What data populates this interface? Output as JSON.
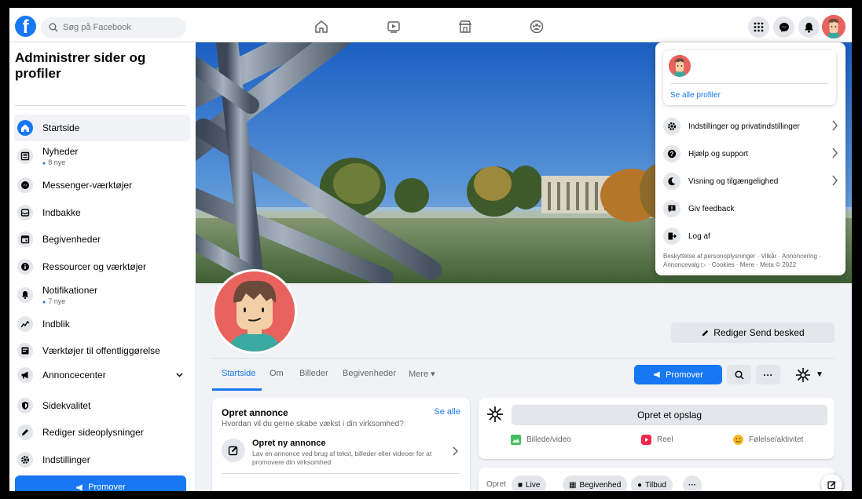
{
  "topbar": {
    "logo_letter": "f",
    "search_placeholder": "Søg på Facebook"
  },
  "sidebar": {
    "title": "Administrer sider og profiler",
    "items": [
      {
        "label": "Startside",
        "icon": "home-icon"
      },
      {
        "label": "Nyheder",
        "sub": "8 nye",
        "icon": "news-icon"
      },
      {
        "label": "Messenger-værktøjer",
        "icon": "messenger-icon"
      },
      {
        "label": "Indbakke",
        "icon": "inbox-icon"
      },
      {
        "label": "Begivenheder",
        "icon": "calendar-icon"
      },
      {
        "label": "Ressourcer og værktøjer",
        "icon": "info-icon"
      },
      {
        "label": "Notifikationer",
        "sub": "7 nye",
        "icon": "bell-icon"
      },
      {
        "label": "Indblik",
        "icon": "insights-icon"
      },
      {
        "label": "Værktøjer til offentliggørelse",
        "icon": "publishing-icon"
      },
      {
        "label": "Annoncecenter",
        "icon": "megaphone-icon"
      },
      {
        "label": "Sidekvalitet",
        "icon": "shield-icon"
      },
      {
        "label": "Rediger sideoplysninger",
        "icon": "pencil-icon"
      },
      {
        "label": "Indstillinger",
        "icon": "gear-icon"
      }
    ],
    "promote_label": "Promover"
  },
  "profile": {
    "edit_label": "Rediger Send besked"
  },
  "tabs": [
    "Startside",
    "Om",
    "Billeder",
    "Begivenheder",
    "Mere"
  ],
  "actions": {
    "promote_label": "Promover"
  },
  "ad_card": {
    "title": "Opret annonce",
    "see_all": "Se alle",
    "subtitle": "Hvordan vil du gerne skabe vækst i din virksomhed?",
    "item_title": "Opret ny annonce",
    "item_desc": "Lav en annonce ved brug af tekst, billeder eller videoer for at promovere din virksomhed"
  },
  "post_card": {
    "create_post": "Opret et opslag",
    "photo_video": "Billede/video",
    "reel": "Reel",
    "feeling": "Følelse/aktivitet"
  },
  "create_card": {
    "label": "Opret",
    "live": "Live",
    "event": "Begivenhed",
    "offer": "Tilbud"
  },
  "menu": {
    "see_profiles": "Se alle profiler",
    "items": [
      {
        "label": "Indstillinger og privatindstillinger",
        "icon": "gear-icon",
        "chevron": true
      },
      {
        "label": "Hjælp og support",
        "icon": "help-icon",
        "chevron": true
      },
      {
        "label": "Visning og tilgængelighed",
        "icon": "moon-icon",
        "chevron": true
      },
      {
        "label": "Giv feedback",
        "icon": "feedback-icon",
        "chevron": false
      },
      {
        "label": "Log af",
        "icon": "logout-icon",
        "chevron": false
      }
    ],
    "footer": "Beskyttelse af personoplysninger · Vilkår · Annoncering · Annoncevalg ▷ · Cookies · Mere · Meta © 2022"
  },
  "colors": {
    "brand": "#1877f2",
    "avatar_bg": "#e8625e",
    "skin": "#f3cfa8",
    "hair": "#6b4a3a",
    "shirt": "#3aa9a0"
  }
}
